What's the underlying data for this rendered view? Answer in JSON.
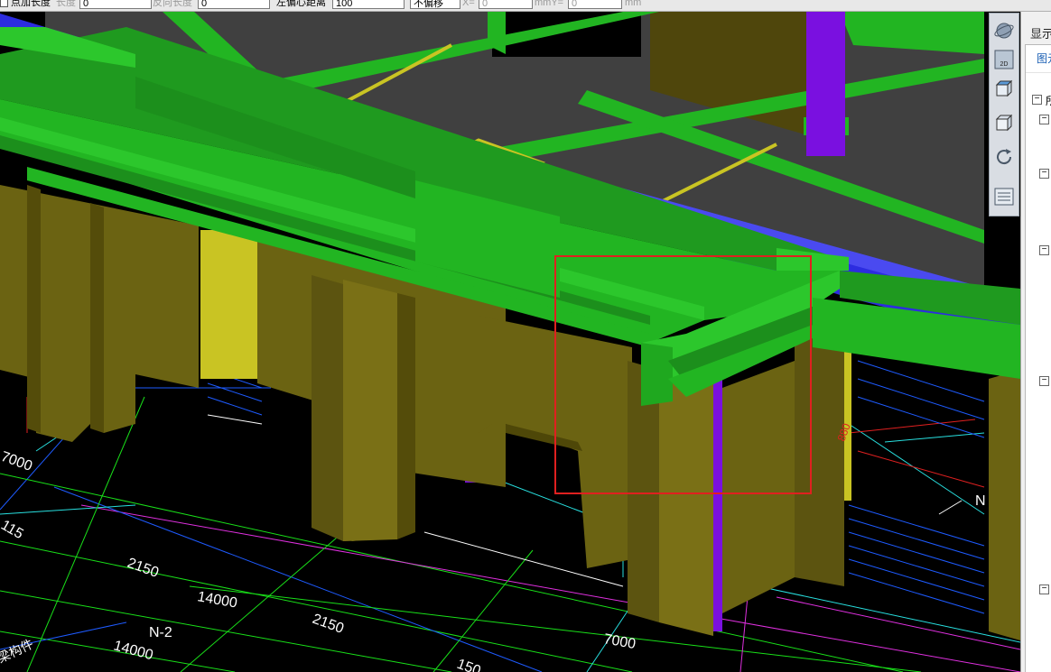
{
  "toolbar": {
    "point_length_label": "点加长度",
    "length_label": "长度",
    "length_value": "0",
    "reverse_length_label": "反向长度",
    "reverse_length_value": "0",
    "left_offset_label": "左偏心距离",
    "left_offset_value": "100",
    "offset_mode": "不偏移",
    "x_label": "X=",
    "x_value": "0",
    "unit_mm_y": "mmY=",
    "y_value": "0",
    "unit_mm": "mm"
  },
  "viewport": {
    "dimension_labels": [
      "7000",
      "115",
      "2150",
      "14000",
      "N-2",
      "2150",
      "14000",
      "7000",
      "150",
      "880",
      "N"
    ],
    "partial_text": "梁构件"
  },
  "right_panel": {
    "tab_label": "显示",
    "subtab_label": "图元",
    "tree_item_label": "所"
  },
  "colors": {
    "beam_green": "#22b522",
    "column_olive": "#6b6312",
    "column_dark": "#4e4708",
    "slab_gray": "#404040",
    "blue_beam": "#2c2ce0",
    "purple_post": "#7a10e0",
    "yellow_wall": "#c9c423",
    "selection_red": "#e02020"
  }
}
